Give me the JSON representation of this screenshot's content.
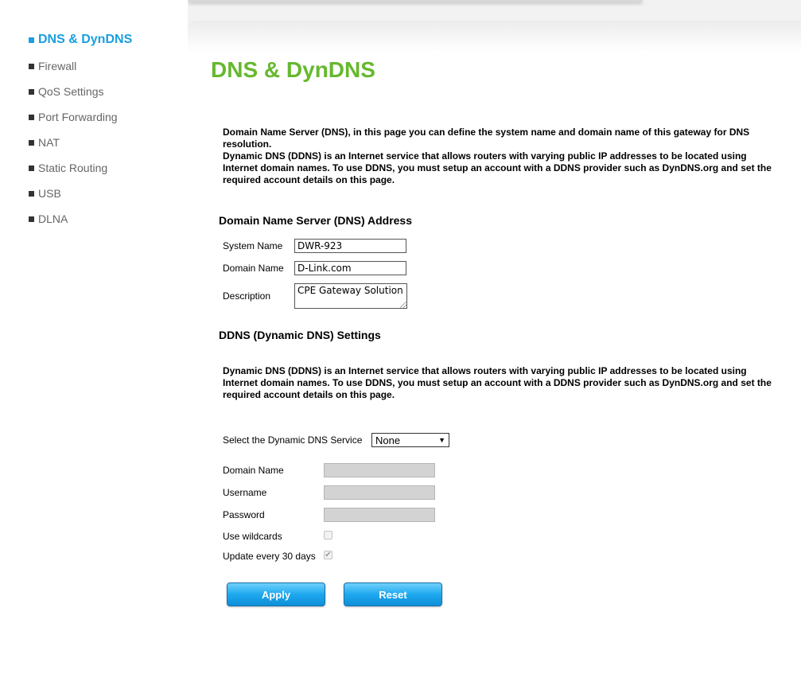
{
  "nav": {
    "items": [
      {
        "label": "DNS & DynDNS",
        "active": true
      },
      {
        "label": "Firewall",
        "active": false
      },
      {
        "label": "QoS Settings",
        "active": false
      },
      {
        "label": "Port Forwarding",
        "active": false
      },
      {
        "label": "NAT",
        "active": false
      },
      {
        "label": "Static Routing",
        "active": false
      },
      {
        "label": "USB",
        "active": false
      },
      {
        "label": "DLNA",
        "active": false
      }
    ]
  },
  "page": {
    "title": "DNS & DynDNS",
    "intro_dns": "Domain Name Server (DNS), in this page you can define the system name and domain name of this gateway for DNS resolution.",
    "intro_ddns": "Dynamic DNS (DDNS) is an Internet service that allows routers with varying public IP addresses to be located using Internet domain names. To use DDNS, you must setup an account with a DDNS provider such as DynDNS.org and set the required account details on this page."
  },
  "dns_section": {
    "title": "Domain Name Server (DNS) Address",
    "system_name_label": "System Name",
    "system_name_value": "DWR-923",
    "domain_name_label": "Domain Name",
    "domain_name_value": "D-Link.com",
    "description_label": "Description",
    "description_value": "CPE Gateway Solution"
  },
  "ddns_section": {
    "title": "DDNS (Dynamic DNS) Settings",
    "description": "Dynamic DNS (DDNS) is an Internet service that allows routers with varying public IP addresses to be located using Internet domain names. To use DDNS, you must setup an account with a DDNS provider such as DynDNS.org and set the required account details on this page.",
    "service_label": "Select the Dynamic DNS Service",
    "service_value": "None",
    "domain_name_label": "Domain Name",
    "username_label": "Username",
    "password_label": "Password",
    "wildcards_label": "Use wildcards",
    "wildcards_checked": false,
    "update_label": "Update every 30 days",
    "update_checked": true
  },
  "buttons": {
    "apply": "Apply",
    "reset": "Reset"
  },
  "colors": {
    "accent_blue": "#1a9ee0",
    "title_green": "#66b82e",
    "button_blue": "#1ea8ef"
  }
}
